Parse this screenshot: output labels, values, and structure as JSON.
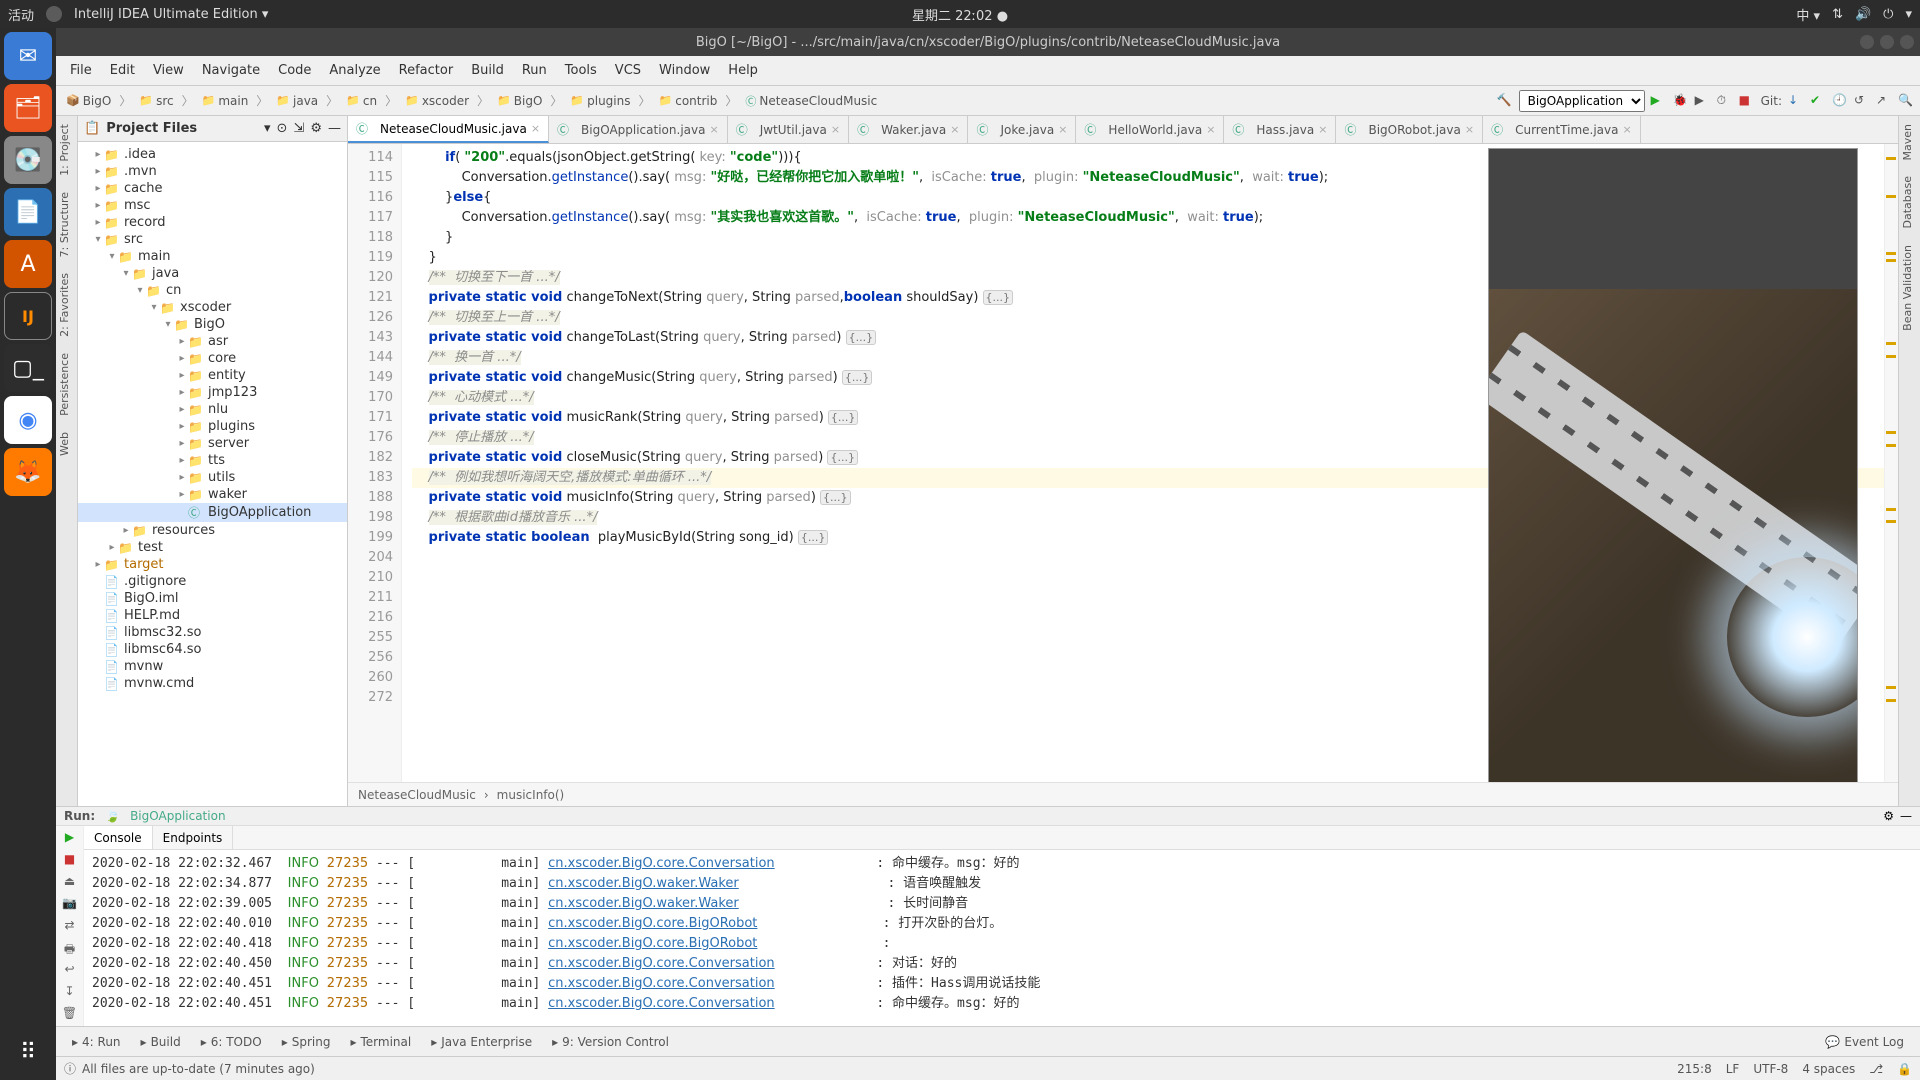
{
  "system": {
    "activities": "活动",
    "app_menu": "IntelliJ IDEA Ultimate Edition ▾",
    "datetime": "星期二 22ː02 ●",
    "ime": "中 ▾"
  },
  "window": {
    "title": "BigO [~/BigO] - .../src/main/java/cn/xscoder/BigO/plugins/contrib/NeteaseCloudMusic.java"
  },
  "menus": [
    "File",
    "Edit",
    "View",
    "Navigate",
    "Code",
    "Analyze",
    "Refactor",
    "Build",
    "Run",
    "Tools",
    "VCS",
    "Window",
    "Help"
  ],
  "breadcrumbs": [
    "BigO",
    "src",
    "main",
    "java",
    "cn",
    "xscoder",
    "BigO",
    "plugins",
    "contrib",
    "NeteaseCloudMusic"
  ],
  "run_config": {
    "selected": "BigOApplication",
    "git_label": "Git:"
  },
  "left_stripe": [
    "1: Project",
    "7: Structure",
    "2: Favorites",
    "Persistence",
    "Web"
  ],
  "right_stripe": [
    "Maven",
    "Database",
    "Bean Validation"
  ],
  "project": {
    "header": "Project Files",
    "tree": [
      {
        "d": 1,
        "l": ".idea",
        "exp": true,
        "icon": "folder"
      },
      {
        "d": 1,
        "l": ".mvn",
        "exp": true,
        "icon": "folder"
      },
      {
        "d": 1,
        "l": "cache",
        "exp": true,
        "icon": "folder"
      },
      {
        "d": 1,
        "l": "msc",
        "exp": true,
        "icon": "folder"
      },
      {
        "d": 1,
        "l": "record",
        "exp": true,
        "icon": "folder"
      },
      {
        "d": 1,
        "l": "src",
        "exp": false,
        "chev": "▾",
        "icon": "folder"
      },
      {
        "d": 2,
        "l": "main",
        "exp": false,
        "chev": "▾",
        "icon": "folder"
      },
      {
        "d": 3,
        "l": "java",
        "exp": false,
        "chev": "▾",
        "icon": "folder"
      },
      {
        "d": 4,
        "l": "cn",
        "exp": false,
        "chev": "▾",
        "icon": "folder"
      },
      {
        "d": 5,
        "l": "xscoder",
        "exp": false,
        "chev": "▾",
        "icon": "folder"
      },
      {
        "d": 6,
        "l": "BigO",
        "exp": false,
        "chev": "▾",
        "icon": "folder"
      },
      {
        "d": 7,
        "l": "asr",
        "exp": false,
        "chev": "▸",
        "icon": "folder"
      },
      {
        "d": 7,
        "l": "core",
        "exp": false,
        "chev": "▸",
        "icon": "folder"
      },
      {
        "d": 7,
        "l": "entity",
        "exp": false,
        "chev": "▸",
        "icon": "folder"
      },
      {
        "d": 7,
        "l": "jmp123",
        "exp": false,
        "chev": "▸",
        "icon": "folder"
      },
      {
        "d": 7,
        "l": "nlu",
        "exp": false,
        "chev": "▸",
        "icon": "folder"
      },
      {
        "d": 7,
        "l": "plugins",
        "exp": false,
        "chev": "▸",
        "icon": "folder"
      },
      {
        "d": 7,
        "l": "server",
        "exp": false,
        "chev": "▸",
        "icon": "folder"
      },
      {
        "d": 7,
        "l": "tts",
        "exp": false,
        "chev": "▸",
        "icon": "folder"
      },
      {
        "d": 7,
        "l": "utils",
        "exp": false,
        "chev": "▸",
        "icon": "folder"
      },
      {
        "d": 7,
        "l": "waker",
        "exp": false,
        "chev": "▸",
        "icon": "folder"
      },
      {
        "d": 7,
        "l": "BigOApplication",
        "icon": "class",
        "selected": true
      },
      {
        "d": 3,
        "l": "resources",
        "exp": false,
        "chev": "▸",
        "icon": "folder"
      },
      {
        "d": 2,
        "l": "test",
        "exp": false,
        "chev": "▸",
        "icon": "folder"
      },
      {
        "d": 1,
        "l": "target",
        "exp": false,
        "chev": "▸",
        "icon": "folder",
        "color": "#b36b00"
      },
      {
        "d": 1,
        "l": ".gitignore",
        "icon": "file"
      },
      {
        "d": 1,
        "l": "BigO.iml",
        "icon": "file"
      },
      {
        "d": 1,
        "l": "HELP.md",
        "icon": "file"
      },
      {
        "d": 1,
        "l": "libmsc32.so",
        "icon": "file"
      },
      {
        "d": 1,
        "l": "libmsc64.so",
        "icon": "file"
      },
      {
        "d": 1,
        "l": "mvnw",
        "icon": "file"
      },
      {
        "d": 1,
        "l": "mvnw.cmd",
        "icon": "file"
      }
    ]
  },
  "tabs": [
    {
      "label": "NeteaseCloudMusic.java",
      "active": true
    },
    {
      "label": "BigOApplication.java"
    },
    {
      "label": "JwtUtil.java"
    },
    {
      "label": "Waker.java"
    },
    {
      "label": "Joke.java"
    },
    {
      "label": "HelloWorld.java"
    },
    {
      "label": "Hass.java"
    },
    {
      "label": "BigORobot.java"
    },
    {
      "label": "CurrentTime.java"
    }
  ],
  "editor": {
    "gutter": [
      "114",
      "115",
      "116",
      "117",
      "118",
      "119",
      "120",
      "121",
      "126",
      "143",
      "144",
      "149",
      "170",
      "171",
      "176",
      "182",
      "183",
      "188",
      "198",
      "199",
      "204",
      "210",
      "211",
      "216",
      "255",
      "256",
      "260",
      "272"
    ],
    "lines_html": [
      "        <span class='kw'>if</span>( <span class='str'>\"200\"</span>.equals(jsonObject.getString( <span class='param'>key:</span> <span class='str'>\"code\"</span>))){",
      "            Conversation.<span class='val'>getInstance</span>().say( <span class='param'>msg:</span> <span class='str'>\"好哒，已经帮你把它加入歌单啦！\"</span>,  <span class='param'>isCache:</span> <span class='kw'>true</span>,  <span class='param'>plugin:</span> <span class='str'>\"NeteaseCloudMusic\"</span>,  <span class='param'>wait:</span> <span class='kw'>true</span>);",
      "        }<span class='kw'>else</span>{",
      "            Conversation.<span class='val'>getInstance</span>().say( <span class='param'>msg:</span> <span class='str'>\"其实我也喜欢这首歌。\"</span>,  <span class='param'>isCache:</span> <span class='kw'>true</span>,  <span class='param'>plugin:</span> <span class='str'>\"NeteaseCloudMusic\"</span>,  <span class='param'>wait:</span> <span class='kw'>true</span>);",
      "        }",
      "    }",
      "",
      "    <span class='cmt'>/**  切换至下一首 ...*/</span>",
      "    <span class='kw'>private static void</span> changeToNext(String <span class='param'>query</span>, String <span class='param'>parsed</span>,<span class='kw'>boolean</span> shouldSay) <span class='fold'>{...}</span>",
      "",
      "    <span class='cmt'>/**  切换至上一首 ...*/</span>",
      "    <span class='kw'>private static void</span> changeToLast(String <span class='param'>query</span>, String <span class='param'>parsed</span>) <span class='fold'>{...}</span>",
      "",
      "    <span class='cmt'>/**  换一首 ...*/</span>",
      "    <span class='kw'>private static void</span> changeMusic(String <span class='param'>query</span>, String <span class='param'>parsed</span>) <span class='fold'>{...}</span>",
      "",
      "    <span class='cmt'>/**  心动模式 ...*/</span>",
      "    <span class='kw'>private static void</span> musicRank(String <span class='param'>query</span>, String <span class='param'>parsed</span>) <span class='fold'>{...}</span>",
      "",
      "    <span class='cmt'>/**  停止播放 ...*/</span>",
      "    <span class='kw'>private static void</span> closeMusic(String <span class='param'>query</span>, String <span class='param'>parsed</span>) <span class='fold'>{...}</span>",
      "",
      "<span class='hl-line'>    <span class='cmt'>/**  例如我想听海阔天空,播放模式:单曲循环 ...*/</span></span>",
      "    <span class='kw'>private static void</span> musicInfo(String <span class='param'>query</span>, String <span class='param'>parsed</span>) <span class='fold'>{...}</span>",
      "",
      "    <span class='cmt'>/**  根据歌曲id播放音乐 ...*/</span>",
      "    <span class='kw'>private static boolean</span>  playMusicById(String song_id) <span class='fold'>{...}</span>",
      ""
    ],
    "bc1": "NeteaseCloudMusic",
    "bc2": "musicInfo()"
  },
  "run": {
    "title": "Run:",
    "conf": "BigOApplication",
    "tabs": [
      "Console",
      "Endpoints"
    ],
    "logs": [
      {
        "t": "2020-02-18 22:02:32.467",
        "lvl": "INFO",
        "pid": "27235",
        "th": "main",
        "cls": "cn.xscoder.BigO.core.Conversation",
        "msg": ": 命中缓存。msg：好的"
      },
      {
        "t": "2020-02-18 22:02:34.877",
        "lvl": "INFO",
        "pid": "27235",
        "th": "main",
        "cls": "cn.xscoder.BigO.waker.Waker",
        "msg": ": 语音唤醒触发"
      },
      {
        "t": "2020-02-18 22:02:39.005",
        "lvl": "INFO",
        "pid": "27235",
        "th": "main",
        "cls": "cn.xscoder.BigO.waker.Waker",
        "msg": ": 长时间静音"
      },
      {
        "t": "2020-02-18 22:02:40.010",
        "lvl": "INFO",
        "pid": "27235",
        "th": "main",
        "cls": "cn.xscoder.BigO.core.BigORobot",
        "msg": ": 打开次卧的台灯。"
      },
      {
        "t": "2020-02-18 22:02:40.418",
        "lvl": "INFO",
        "pid": "27235",
        "th": "main",
        "cls": "cn.xscoder.BigO.core.BigORobot",
        "msg": ":"
      },
      {
        "t": "2020-02-18 22:02:40.450",
        "lvl": "INFO",
        "pid": "27235",
        "th": "main",
        "cls": "cn.xscoder.BigO.core.Conversation",
        "msg": ": 对话：好的"
      },
      {
        "t": "2020-02-18 22:02:40.451",
        "lvl": "INFO",
        "pid": "27235",
        "th": "main",
        "cls": "cn.xscoder.BigO.core.Conversation",
        "msg": ": 插件：Hass调用说话技能"
      },
      {
        "t": "2020-02-18 22:02:40.451",
        "lvl": "INFO",
        "pid": "27235",
        "th": "main",
        "cls": "cn.xscoder.BigO.core.Conversation",
        "msg": ": 命中缓存。msg：好的"
      }
    ]
  },
  "bottom_tools": [
    "4: Run",
    "Build",
    "6: TODO",
    "Spring",
    "Terminal",
    "Java Enterprise",
    "9: Version Control"
  ],
  "bottom_right": "Event Log",
  "status": {
    "left": "All files are up-to-date (7 minutes ago)",
    "pos": "215:8",
    "le": "LF",
    "enc": "UTF-8",
    "indent": "4 spaces",
    "git_icon": "⎇"
  }
}
